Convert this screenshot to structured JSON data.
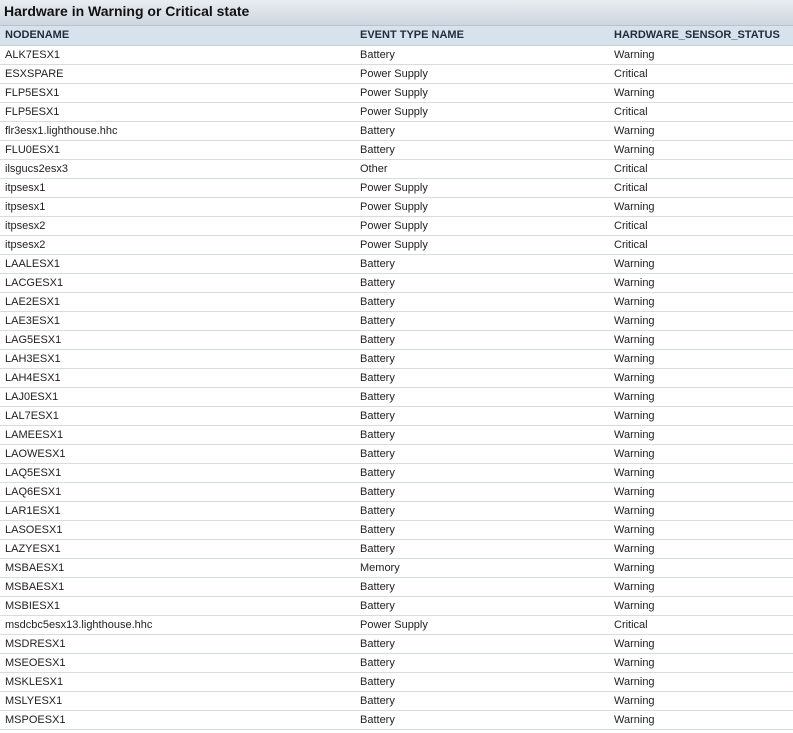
{
  "report": {
    "title": "Hardware in Warning or Critical state",
    "columns": [
      "NODENAME",
      "EVENT TYPE NAME",
      "HARDWARE_SENSOR_STATUS"
    ],
    "rows": [
      [
        "ALK7ESX1",
        "Battery",
        "Warning"
      ],
      [
        "ESXSPARE",
        "Power Supply",
        "Critical"
      ],
      [
        "FLP5ESX1",
        "Power Supply",
        "Warning"
      ],
      [
        "FLP5ESX1",
        "Power Supply",
        "Critical"
      ],
      [
        "flr3esx1.lighthouse.hhc",
        "Battery",
        "Warning"
      ],
      [
        "FLU0ESX1",
        "Battery",
        "Warning"
      ],
      [
        "ilsgucs2esx3",
        "Other",
        "Critical"
      ],
      [
        "itpsesx1",
        "Power Supply",
        "Critical"
      ],
      [
        "itpsesx1",
        "Power Supply",
        "Warning"
      ],
      [
        "itpsesx2",
        "Power Supply",
        "Critical"
      ],
      [
        "itpsesx2",
        "Power Supply",
        "Critical"
      ],
      [
        "LAALESX1",
        "Battery",
        "Warning"
      ],
      [
        "LACGESX1",
        "Battery",
        "Warning"
      ],
      [
        "LAE2ESX1",
        "Battery",
        "Warning"
      ],
      [
        "LAE3ESX1",
        "Battery",
        "Warning"
      ],
      [
        "LAG5ESX1",
        "Battery",
        "Warning"
      ],
      [
        "LAH3ESX1",
        "Battery",
        "Warning"
      ],
      [
        "LAH4ESX1",
        "Battery",
        "Warning"
      ],
      [
        "LAJ0ESX1",
        "Battery",
        "Warning"
      ],
      [
        "LAL7ESX1",
        "Battery",
        "Warning"
      ],
      [
        "LAMEESX1",
        "Battery",
        "Warning"
      ],
      [
        "LAOWESX1",
        "Battery",
        "Warning"
      ],
      [
        "LAQ5ESX1",
        "Battery",
        "Warning"
      ],
      [
        "LAQ6ESX1",
        "Battery",
        "Warning"
      ],
      [
        "LAR1ESX1",
        "Battery",
        "Warning"
      ],
      [
        "LASOESX1",
        "Battery",
        "Warning"
      ],
      [
        "LAZYESX1",
        "Battery",
        "Warning"
      ],
      [
        "MSBAESX1",
        "Memory",
        "Warning"
      ],
      [
        "MSBAESX1",
        "Battery",
        "Warning"
      ],
      [
        "MSBIESX1",
        "Battery",
        "Warning"
      ],
      [
        "msdcbc5esx13.lighthouse.hhc",
        "Power Supply",
        "Critical"
      ],
      [
        "MSDRESX1",
        "Battery",
        "Warning"
      ],
      [
        "MSEOESX1",
        "Battery",
        "Warning"
      ],
      [
        "MSKLESX1",
        "Battery",
        "Warning"
      ],
      [
        "MSLYESX1",
        "Battery",
        "Warning"
      ],
      [
        "MSPOESX1",
        "Battery",
        "Warning"
      ]
    ]
  }
}
